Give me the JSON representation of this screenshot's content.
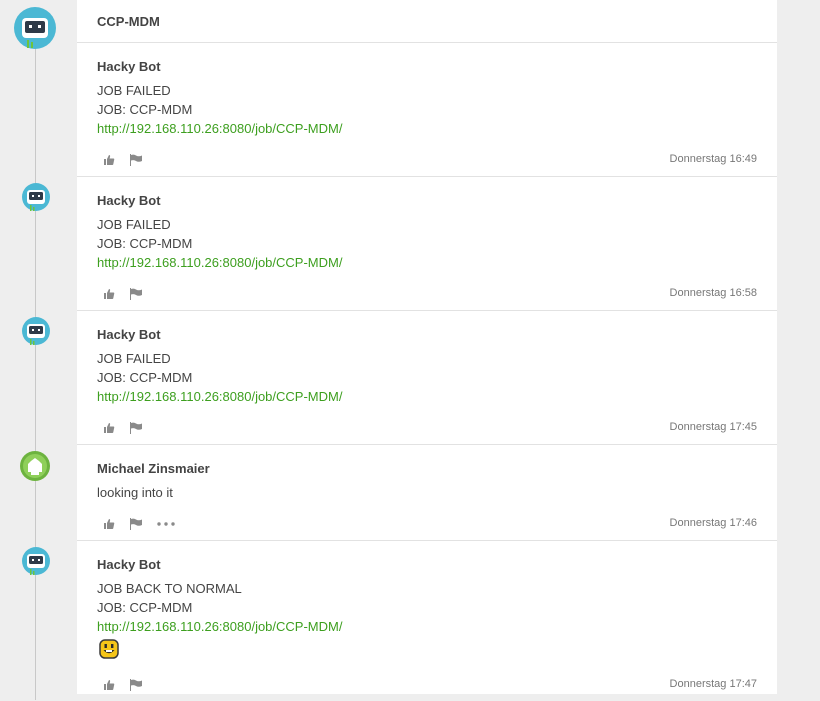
{
  "channel": {
    "title": "CCP-MDM"
  },
  "messages": [
    {
      "author": "Hacky Bot",
      "lines": [
        "JOB FAILED",
        "JOB: CCP-MDM"
      ],
      "link": "http://192.168.110.26:8080/job/CCP-MDM/",
      "time": "Donnerstag 16:49"
    },
    {
      "author": "Hacky Bot",
      "lines": [
        "JOB FAILED",
        "JOB: CCP-MDM"
      ],
      "link": "http://192.168.110.26:8080/job/CCP-MDM/",
      "time": "Donnerstag 16:58"
    },
    {
      "author": "Hacky Bot",
      "lines": [
        "JOB FAILED",
        "JOB: CCP-MDM"
      ],
      "link": "http://192.168.110.26:8080/job/CCP-MDM/",
      "time": "Donnerstag 17:45"
    },
    {
      "author": "Michael Zinsmaier",
      "lines": [
        "looking into it"
      ],
      "time": "Donnerstag 17:46"
    },
    {
      "author": "Hacky Bot",
      "lines": [
        "JOB BACK TO NORMAL",
        "JOB: CCP-MDM"
      ],
      "link": "http://192.168.110.26:8080/job/CCP-MDM/",
      "time": "Donnerstag 17:47",
      "emoji": "smiley-emoji-icon"
    }
  ],
  "colors": {
    "link": "#3d9f1f",
    "bot_avatar": "#4bb8d4",
    "user_avatar": "#6db33f",
    "emoji": "#f5c518"
  },
  "icons": [
    "robot-avatar-icon",
    "user-avatar-icon",
    "thumbs-up-icon",
    "flag-icon",
    "more-options-icon",
    "smiley-emoji-icon"
  ]
}
